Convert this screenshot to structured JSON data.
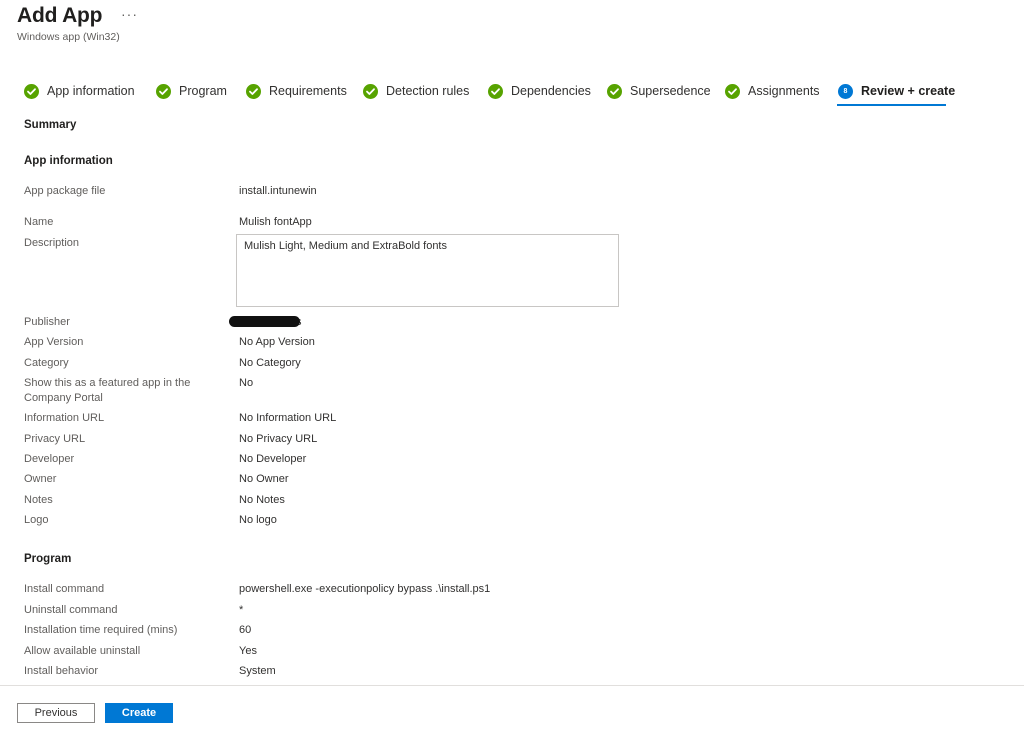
{
  "header": {
    "title": "Add App",
    "more_label": "···",
    "subtitle": "Windows app (Win32)"
  },
  "tabs": [
    {
      "label": "App information",
      "icon": "check-circle-icon",
      "status": "complete"
    },
    {
      "label": "Program",
      "icon": "check-circle-icon",
      "status": "complete"
    },
    {
      "label": "Requirements",
      "icon": "check-circle-icon",
      "status": "complete"
    },
    {
      "label": "Detection rules",
      "icon": "check-circle-icon",
      "status": "complete"
    },
    {
      "label": "Dependencies",
      "icon": "check-circle-icon",
      "status": "complete"
    },
    {
      "label": "Supersedence",
      "icon": "check-circle-icon",
      "status": "complete"
    },
    {
      "label": "Assignments",
      "icon": "check-circle-icon",
      "status": "complete"
    },
    {
      "label": "Review + create",
      "step": "8",
      "status": "active"
    }
  ],
  "summary_label": "Summary",
  "app_info": {
    "heading": "App information",
    "rows": [
      {
        "label": "App package file",
        "value": "install.intunewin"
      },
      {
        "label": "Name",
        "value": "Mulish fontApp"
      },
      {
        "label": "Description",
        "value": "Mulish Light, Medium and ExtraBold fonts"
      },
      {
        "label": "Publisher",
        "value": "s"
      },
      {
        "label": "App Version",
        "value": "No App Version"
      },
      {
        "label": "Category",
        "value": "No Category"
      },
      {
        "label": "Show this as a featured app in the Company Portal",
        "value": "No"
      },
      {
        "label": "Information URL",
        "value": "No Information URL"
      },
      {
        "label": "Privacy URL",
        "value": "No Privacy URL"
      },
      {
        "label": "Developer",
        "value": "No Developer"
      },
      {
        "label": "Owner",
        "value": "No Owner"
      },
      {
        "label": "Notes",
        "value": "No Notes"
      },
      {
        "label": "Logo",
        "value": "No logo"
      }
    ]
  },
  "program": {
    "heading": "Program",
    "rows": [
      {
        "label": "Install command",
        "value": "powershell.exe -executionpolicy bypass .\\install.ps1"
      },
      {
        "label": "Uninstall command",
        "value": "*"
      },
      {
        "label": "Installation time required (mins)",
        "value": "60"
      },
      {
        "label": "Allow available uninstall",
        "value": "Yes"
      },
      {
        "label": "Install behavior",
        "value": "System"
      }
    ]
  },
  "footer": {
    "previous_label": "Previous",
    "create_label": "Create"
  },
  "colors": {
    "accent": "#0078d4",
    "success": "#57a300"
  }
}
